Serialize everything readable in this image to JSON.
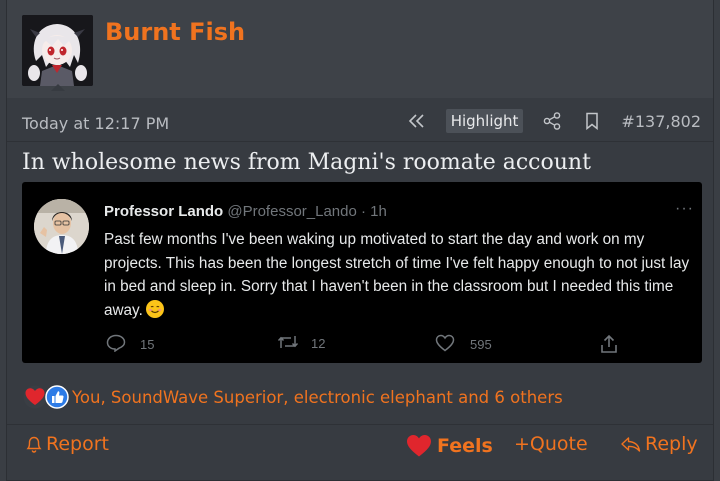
{
  "post": {
    "username": "Burnt Fish",
    "timestamp": "Today at 12:17 PM",
    "highlight_label": "Highlight",
    "post_number": "#137,802",
    "title": "In wholesome news from Magni's roomate account"
  },
  "tweet": {
    "name": "Professor Lando",
    "handle": "@Professor_Lando · 1h",
    "more": "···",
    "text": "Past few months I've been waking up motivated to start the day and work on my projects. This has been the longest stretch of time I've felt happy enough to not just lay in bed and sleep in. Sorry that I haven't been in the classroom but I needed this time away.",
    "replies": "15",
    "retweets": "12",
    "likes": "595"
  },
  "reactions": {
    "text": "You, SoundWave Superior, electronic elephant and 6 others"
  },
  "footer": {
    "report": "Report",
    "feels": "Feels",
    "quote": "+Quote",
    "reply": "Reply"
  },
  "colors": {
    "accent": "#f0731f",
    "background": "#373b41",
    "tweet_bg": "#000000"
  }
}
